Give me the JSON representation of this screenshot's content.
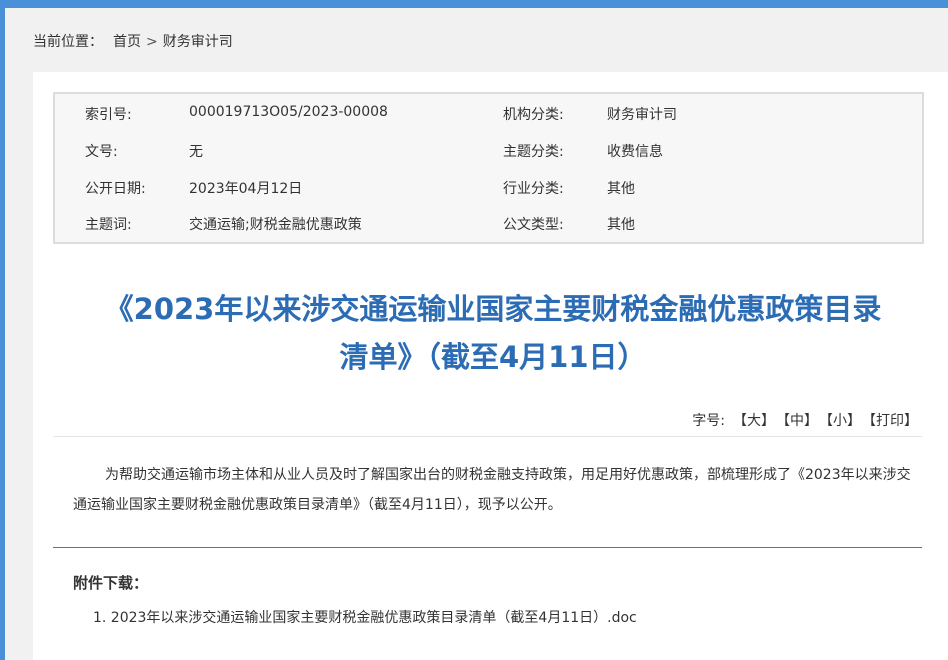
{
  "breadcrumb": {
    "prefix": "当前位置：",
    "home": "首页",
    "separator": ">",
    "current": "财务审计司"
  },
  "meta": {
    "rows": [
      {
        "k1": "索引号:",
        "v1": "000019713O05/2023-00008",
        "k2": "机构分类:",
        "v2": "财务审计司"
      },
      {
        "k1": "文号:",
        "v1": "无",
        "k2": "主题分类:",
        "v2": "收费信息"
      },
      {
        "k1": "公开日期:",
        "v1": "2023年04月12日",
        "k2": "行业分类:",
        "v2": "其他"
      },
      {
        "k1": "主题词:",
        "v1": "交通运输;财税金融优惠政策",
        "k2": "公文类型:",
        "v2": "其他"
      }
    ]
  },
  "article": {
    "title_line1": "《2023年以来涉交通运输业国家主要财税金融优惠政策目录",
    "title_line2": "清单》（截至4月11日）",
    "font_size_label": "字号:",
    "font_large": "【大】",
    "font_medium": "【中】",
    "font_small": "【小】",
    "print": "【打印】",
    "body": "为帮助交通运输市场主体和从业人员及时了解国家出台的财税金融支持政策，用足用好优惠政策，部梳理形成了《2023年以来涉交通运输业国家主要财税金融优惠政策目录清单》（截至4月11日），现予以公开。"
  },
  "attachments": {
    "title": "附件下载：",
    "items": [
      {
        "label": "1. 2023年以来涉交通运输业国家主要财税金融优惠政策目录清单（截至4月11日）.doc"
      }
    ]
  },
  "colors": {
    "accent": "#4a90d9",
    "title": "#2b6cb4"
  }
}
